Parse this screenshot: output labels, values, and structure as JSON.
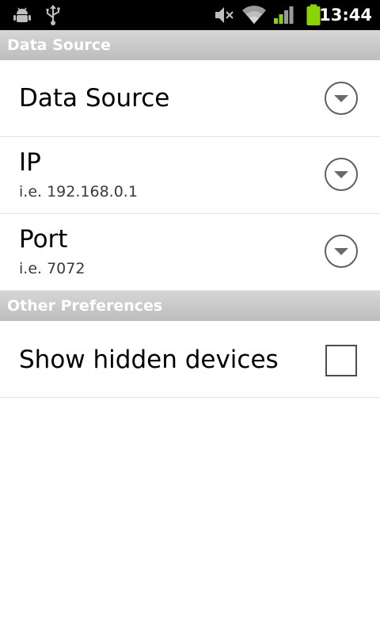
{
  "status_bar": {
    "time": "13:44",
    "icons": [
      "android-debug-icon",
      "usb-icon",
      "mute-icon",
      "wifi-icon",
      "signal-icon",
      "battery-icon"
    ],
    "battery_color": "#8ad400"
  },
  "categories": [
    {
      "title": "Data Source",
      "items": [
        {
          "title": "Data Source",
          "summary": "",
          "widget": "dropdown"
        },
        {
          "title": "IP",
          "summary": "i.e. 192.168.0.1",
          "widget": "dropdown"
        },
        {
          "title": "Port",
          "summary": "i.e. 7072",
          "widget": "dropdown"
        }
      ]
    },
    {
      "title": "Other Preferences",
      "items": [
        {
          "title": "Show hidden devices",
          "summary": "",
          "widget": "checkbox",
          "checked": false
        }
      ]
    }
  ],
  "colors": {
    "category_bg": "#c9c9c9",
    "divider": "#e3e3e3",
    "status_bar_bg": "#000000"
  }
}
